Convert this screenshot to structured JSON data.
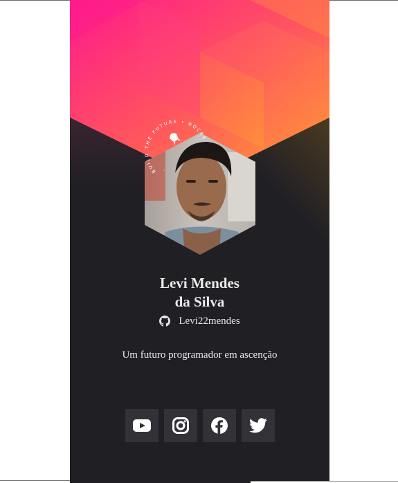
{
  "profile": {
    "name_line1": "Levi Mendes",
    "name_line2": "da Silva",
    "handle": "Levi22mendes",
    "bio": "Um futuro programador em ascenção"
  },
  "badge": {
    "text": "BUILD THE FUTURE • ROCKETSEAT •"
  },
  "icons": {
    "github": "github-icon",
    "youtube": "youtube-icon",
    "instagram": "instagram-icon",
    "facebook": "facebook-icon",
    "twitter": "twitter-icon"
  },
  "colors": {
    "card_bg": "#1f1f24",
    "button_bg": "#323238",
    "gradient_pink": "#ff1a8c",
    "gradient_orange": "#ff7a3d",
    "gradient_yellow": "#ffb02e"
  }
}
